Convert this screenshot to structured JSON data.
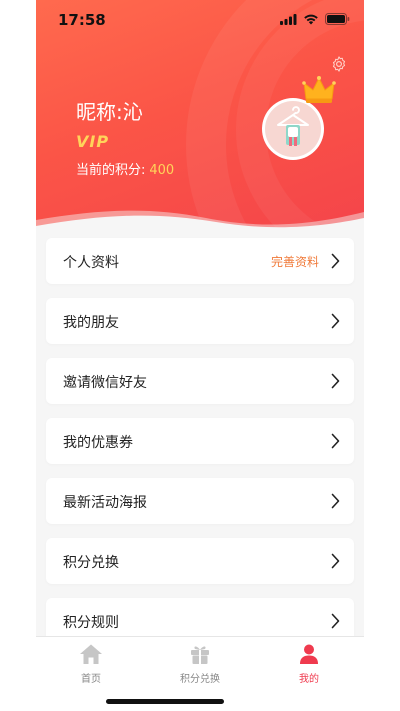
{
  "status": {
    "time": "17:58"
  },
  "profile": {
    "nickname": "昵称:沁",
    "vip": "VIP",
    "points_label": "当前的积分:",
    "points_value": "400"
  },
  "menu": [
    {
      "label": "个人资料",
      "extra": "完善资料"
    },
    {
      "label": "我的朋友",
      "extra": ""
    },
    {
      "label": "邀请微信好友",
      "extra": ""
    },
    {
      "label": "我的优惠券",
      "extra": ""
    },
    {
      "label": "最新活动海报",
      "extra": ""
    },
    {
      "label": "积分兑换",
      "extra": ""
    },
    {
      "label": "积分规则",
      "extra": ""
    }
  ],
  "tabs": [
    {
      "label": "首页",
      "icon": "home-icon",
      "active": false
    },
    {
      "label": "积分兑换",
      "icon": "gift-icon",
      "active": false
    },
    {
      "label": "我的",
      "icon": "user-icon",
      "active": true
    }
  ],
  "colors": {
    "header_gradient_start": "#ff6a4e",
    "header_gradient_end": "#f4444a",
    "accent": "#ef3a4e",
    "vip_gold": "#ffd45a",
    "extra_orange": "#f07a3a"
  }
}
